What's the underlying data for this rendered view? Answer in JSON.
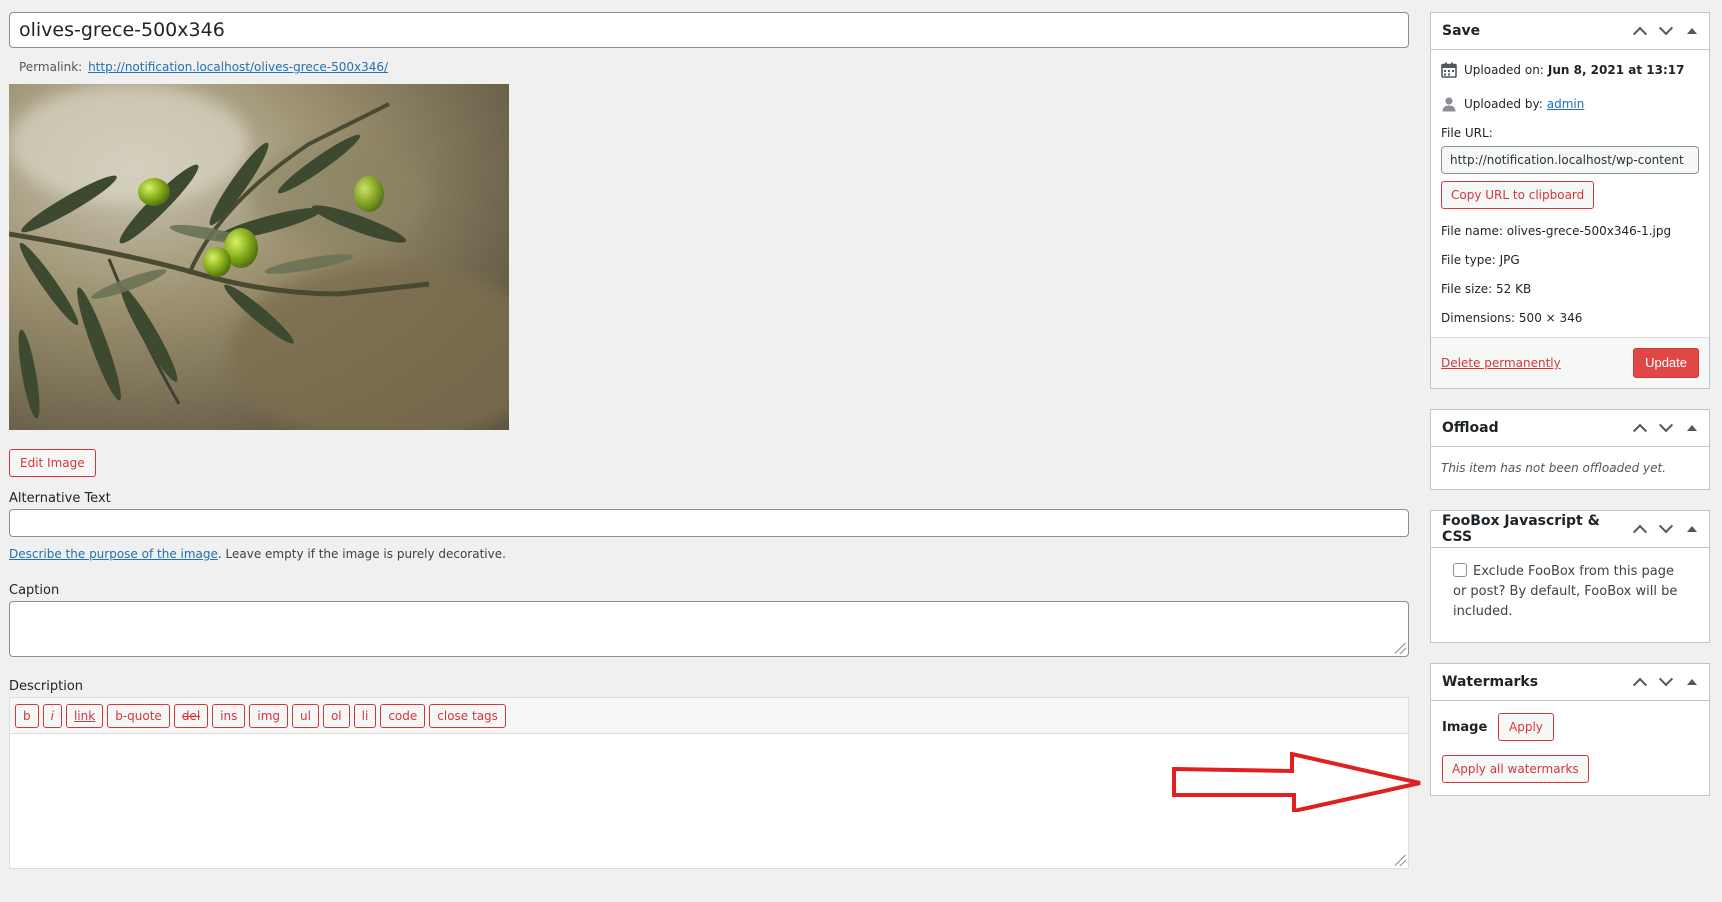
{
  "title": {
    "value": "olives-grece-500x346"
  },
  "permalink": {
    "label": "Permalink:",
    "url": "http://notification.localhost/olives-grece-500x346/"
  },
  "edit_image_label": "Edit Image",
  "alt_text": {
    "label": "Alternative Text",
    "value": "",
    "help_link": "Describe the purpose of the image",
    "help_rest": ". Leave empty if the image is purely decorative."
  },
  "caption": {
    "label": "Caption",
    "value": ""
  },
  "description": {
    "label": "Description",
    "toolbar": [
      "b",
      "i",
      "link",
      "b-quote",
      "del",
      "ins",
      "img",
      "ul",
      "ol",
      "li",
      "code",
      "close tags"
    ],
    "value": ""
  },
  "save_box": {
    "title": "Save",
    "uploaded_on_label": "Uploaded on:",
    "uploaded_on_value": "Jun 8, 2021 at 13:17",
    "uploaded_by_label": "Uploaded by:",
    "uploaded_by_value": "admin",
    "file_url_label": "File URL:",
    "file_url_value": "http://notification.localhost/wp-content",
    "copy_url_label": "Copy URL to clipboard",
    "file_name_label": "File name:",
    "file_name_value": "olives-grece-500x346-1.jpg",
    "file_type_label": "File type:",
    "file_type_value": "JPG",
    "file_size_label": "File size:",
    "file_size_value": "52 KB",
    "dimensions_label": "Dimensions:",
    "dimensions_value": "500 × 346",
    "delete_label": "Delete permanently",
    "update_label": "Update"
  },
  "offload_box": {
    "title": "Offload",
    "note": "This item has not been offloaded yet."
  },
  "foobox_box": {
    "title": "FooBox Javascript & CSS",
    "checkbox_label": "Exclude FooBox from this page or post? By default, FooBox will be included.",
    "checked": false
  },
  "watermarks_box": {
    "title": "Watermarks",
    "image_label": "Image",
    "apply_label": "Apply",
    "apply_all_label": "Apply all watermarks"
  },
  "colors": {
    "accent_red": "#d63638",
    "link_blue": "#2271b1",
    "annotation_arrow": "#e02020"
  }
}
